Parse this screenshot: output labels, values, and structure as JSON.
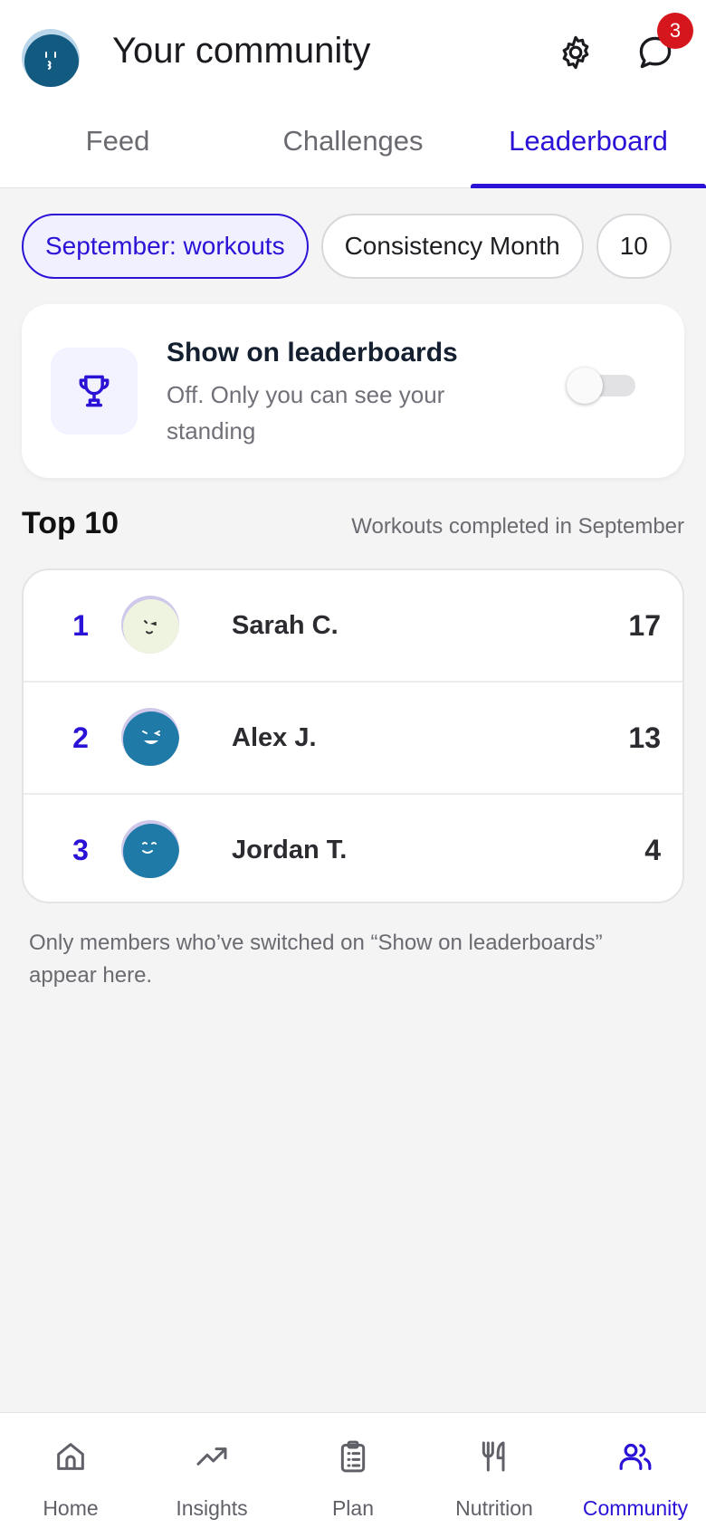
{
  "header": {
    "title": "Your community",
    "notification_count": "3",
    "avatar_icon": "user-avatar",
    "settings_icon": "gear-icon",
    "chat_icon": "chat-bubble-icon"
  },
  "tabs": [
    {
      "label": "Feed",
      "active": false
    },
    {
      "label": "Challenges",
      "active": false
    },
    {
      "label": "Leaderboard",
      "active": true
    }
  ],
  "chips": [
    {
      "label": "September: workouts",
      "selected": true
    },
    {
      "label": "Consistency Month",
      "selected": false
    },
    {
      "label": "10",
      "selected": false
    }
  ],
  "visibility_card": {
    "title": "Show on leaderboards",
    "description": "Off. Only you can see your standing",
    "enabled": false,
    "icon": "trophy-icon"
  },
  "leaderboard": {
    "title": "Top 10",
    "subtitle": "Workouts completed in September",
    "rows": [
      {
        "rank": "1",
        "name": "Sarah C.",
        "score": "17",
        "avatar_color": "#eef4e0"
      },
      {
        "rank": "2",
        "name": "Alex J.",
        "score": "13",
        "avatar_color": "#1f7aa8"
      },
      {
        "rank": "3",
        "name": "Jordan T.",
        "score": "4",
        "avatar_color": "#1f7aa8"
      }
    ],
    "footnote": "Only members who’ve switched on “Show on leaderboards” appear here."
  },
  "bottom_nav": [
    {
      "label": "Home",
      "icon": "home-icon",
      "active": false
    },
    {
      "label": "Insights",
      "icon": "trend-icon",
      "active": false
    },
    {
      "label": "Plan",
      "icon": "clipboard-icon",
      "active": false
    },
    {
      "label": "Nutrition",
      "icon": "fork-knife-icon",
      "active": false
    },
    {
      "label": "Community",
      "icon": "people-icon",
      "active": true
    }
  ],
  "colors": {
    "accent": "#2a12d6",
    "badge": "#d6161d",
    "background": "#f4f4f5"
  }
}
